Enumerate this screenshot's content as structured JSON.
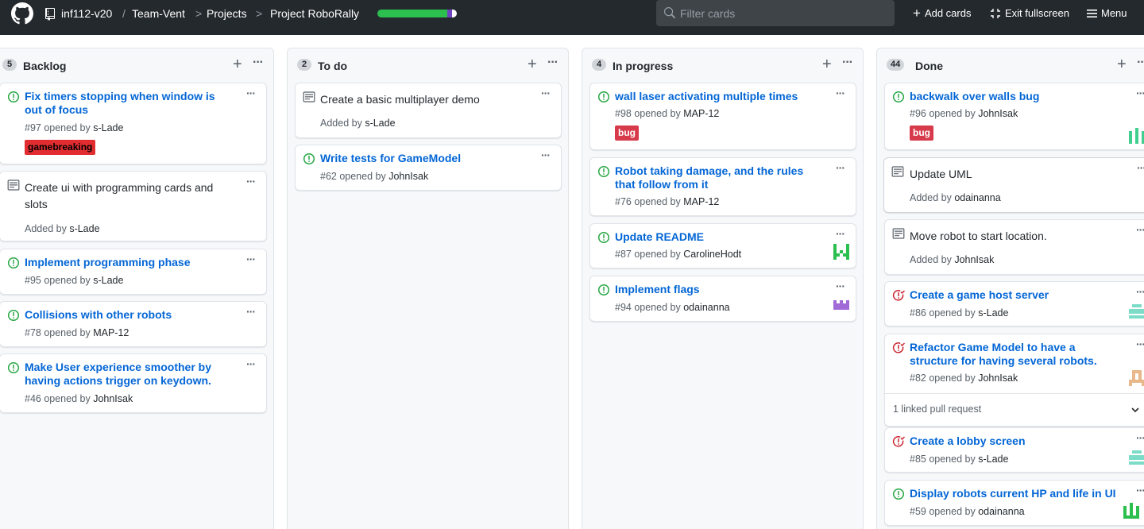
{
  "header": {
    "breadcrumb": {
      "org": "inf112-v20",
      "sep1": "/",
      "team": "Team-Vent",
      "sep2": ">",
      "projects": "Projects",
      "sep3": ">",
      "project": "Project RoboRally"
    },
    "progress": {
      "done_pct": 88,
      "in_progress_pct": 6,
      "todo_pct": 6,
      "done_color": "#2cbe4e",
      "in_progress_color": "#6f42c1",
      "todo_color": "#ffffff"
    },
    "search_placeholder": "Filter cards",
    "add_cards": "Add cards",
    "exit_fullscreen": "Exit fullscreen",
    "menu": "Menu"
  },
  "columns": [
    {
      "name": "Backlog",
      "count": "5",
      "cards": [
        {
          "kind": "issue",
          "title": "Fix timers stopping when window is out of focus",
          "meta_prefix": "#97 opened by",
          "author": "s-Lade",
          "label": {
            "text": "gamebreaking",
            "color": "#e12d30",
            "text_color": "#000000"
          }
        },
        {
          "kind": "note",
          "title": "Create ui with programming cards and slots",
          "meta_prefix": "Added by",
          "author": "s-Lade"
        },
        {
          "kind": "issue",
          "title": "Implement programming phase",
          "meta_prefix": "#95 opened by",
          "author": "s-Lade"
        },
        {
          "kind": "issue",
          "title": "Collisions with other robots",
          "meta_prefix": "#78 opened by",
          "author": "MAP-12"
        },
        {
          "kind": "issue",
          "title": "Make User experience smoother by having actions trigger on keydown.",
          "meta_prefix": "#46 opened by",
          "author": "JohnIsak"
        }
      ]
    },
    {
      "name": "To do",
      "count": "2",
      "cards": [
        {
          "kind": "note",
          "title": "Create a basic multiplayer demo",
          "meta_prefix": "Added by",
          "author": "s-Lade"
        },
        {
          "kind": "issue",
          "title": "Write tests for GameModel",
          "meta_prefix": "#62 opened by",
          "author": "JohnIsak"
        }
      ]
    },
    {
      "name": "In progress",
      "count": "4",
      "cards": [
        {
          "kind": "issue",
          "title": "wall laser activating multiple times",
          "meta_prefix": "#98 opened by",
          "author": "MAP-12",
          "label": {
            "text": "bug",
            "color": "#d73a4a",
            "text_color": "#ffffff"
          }
        },
        {
          "kind": "issue",
          "title": "Robot taking damage, and the rules that follow from it",
          "meta_prefix": "#76 opened by",
          "author": "MAP-12"
        },
        {
          "kind": "issue",
          "title": "Update README",
          "meta_prefix": "#87 opened by",
          "author": "CarolineHodt",
          "avatar_color": "#2cbe4e"
        },
        {
          "kind": "issue",
          "title": "Implement flags",
          "meta_prefix": "#94 opened by",
          "author": "odainanna",
          "avatar_color": "#a06bd6"
        }
      ]
    },
    {
      "name": "Done",
      "count": "44",
      "cards": [
        {
          "kind": "issue",
          "title": "backwalk over walls bug",
          "meta_prefix": "#96 opened by",
          "author": "JohnIsak",
          "label": {
            "text": "bug",
            "color": "#d73a4a",
            "text_color": "#ffffff"
          },
          "avatar_color": "#3fcf8e"
        },
        {
          "kind": "note",
          "title": "Update UML",
          "meta_prefix": "Added by",
          "author": "odainanna"
        },
        {
          "kind": "note",
          "title": "Move robot to start location.",
          "meta_prefix": "Added by",
          "author": "JohnIsak"
        },
        {
          "kind": "closed",
          "title": "Create a game host server",
          "meta_prefix": "#86 opened by",
          "author": "s-Lade",
          "avatar_color": "#7ddcc8"
        },
        {
          "kind": "closed",
          "title": "Refactor Game Model to have a structure for having several robots.",
          "meta_prefix": "#82 opened by",
          "author": "JohnIsak",
          "avatar_color": "#e8b88a",
          "linked": "1 linked pull request"
        },
        {
          "kind": "closed",
          "title": "Create a lobby screen",
          "meta_prefix": "#85 opened by",
          "author": "s-Lade",
          "avatar_color": "#7ddcc8"
        },
        {
          "kind": "issue",
          "title": "Display robots current HP and life in UI",
          "meta_prefix": "#59 opened by",
          "author": "odainanna",
          "avatar_color": "#2cbe4e"
        }
      ]
    }
  ]
}
